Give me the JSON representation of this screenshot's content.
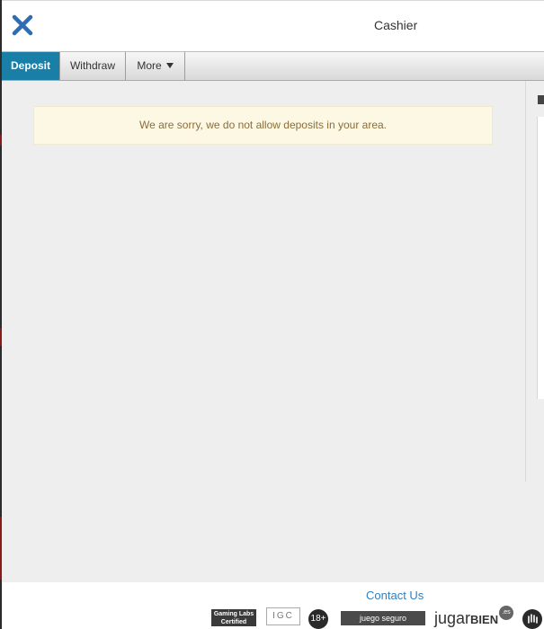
{
  "header": {
    "title": "Cashier",
    "close_icon": "close-icon",
    "close_color": "#2f6db3"
  },
  "tabs": [
    {
      "label": "Deposit",
      "active": true
    },
    {
      "label": "Withdraw",
      "active": false
    },
    {
      "label": "More",
      "active": false,
      "icon": "caret-down-icon"
    }
  ],
  "notice": {
    "message": "We are sorry, we do not allow deposits in your area."
  },
  "footer": {
    "contact_label": "Contact Us",
    "badges": {
      "gaming": "Gaming Labs Certified",
      "igc": "IGC",
      "age": "18+",
      "juego": "juego seguro",
      "jugar": "jugar",
      "jugar_bold": "BIEN",
      "es": ".es"
    }
  },
  "colors": {
    "accent": "#1a7fa6",
    "notice_bg": "#fcf8e3",
    "notice_text": "#8a6d3b",
    "link": "#2f7fc1"
  }
}
